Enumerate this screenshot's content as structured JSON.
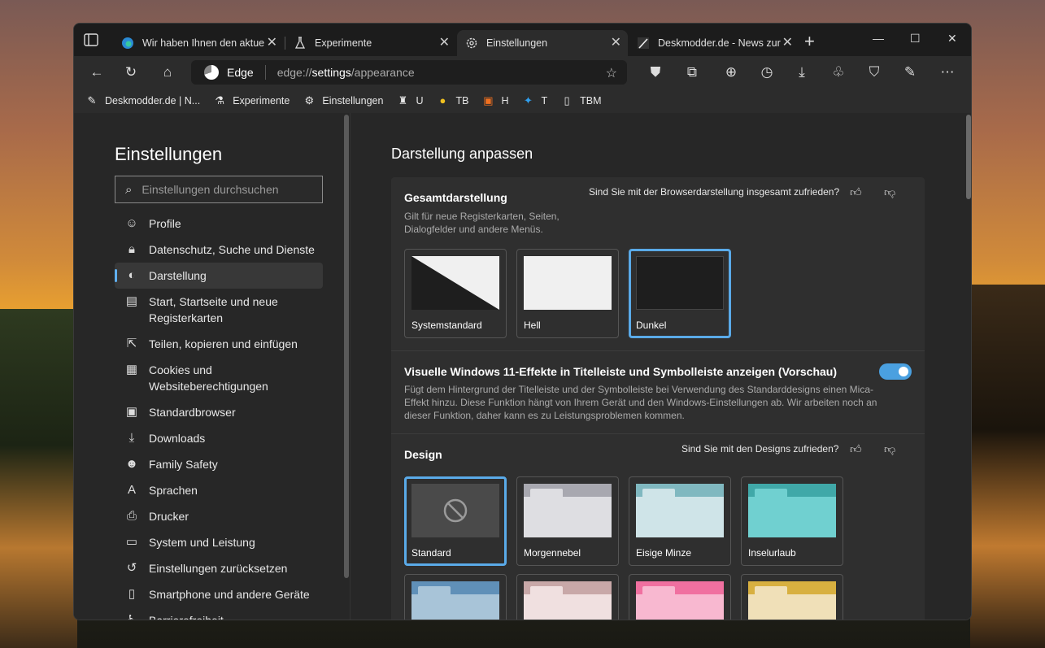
{
  "tabs": [
    {
      "title": "Wir haben Ihnen den aktue",
      "icon": "edge-icon"
    },
    {
      "title": "Experimente",
      "icon": "flask-icon"
    },
    {
      "title": "Einstellungen",
      "icon": "gear-icon"
    },
    {
      "title": "Deskmodder.de - News zur",
      "icon": "feather-icon"
    }
  ],
  "address": {
    "label": "Edge",
    "url_prefix": "edge://",
    "url_bold": "settings",
    "url_rest": "/appearance"
  },
  "bookmarks": [
    {
      "label": "Deskmodder.de | N...",
      "icon": "feather-icon"
    },
    {
      "label": "Experimente",
      "icon": "flask-icon"
    },
    {
      "label": "Einstellungen",
      "icon": "gear-icon"
    },
    {
      "label": "U",
      "icon": "u-icon"
    },
    {
      "label": "TB",
      "icon": "tb-icon"
    },
    {
      "label": "H",
      "icon": "h-icon"
    },
    {
      "label": "T",
      "icon": "twitter-icon"
    },
    {
      "label": "TBM",
      "icon": "page-icon"
    }
  ],
  "sidebar": {
    "title": "Einstellungen",
    "search_placeholder": "Einstellungen durchsuchen",
    "items": [
      {
        "label": "Profile",
        "icon": "profile-icon"
      },
      {
        "label": "Datenschutz, Suche und Dienste",
        "icon": "lock-icon"
      },
      {
        "label": "Darstellung",
        "icon": "palette-icon"
      },
      {
        "label": "Start, Startseite und neue Registerkarten",
        "icon": "home-grid-icon"
      },
      {
        "label": "Teilen, kopieren und einfügen",
        "icon": "share-icon"
      },
      {
        "label": "Cookies und Websiteberechtigungen",
        "icon": "cookie-icon"
      },
      {
        "label": "Standardbrowser",
        "icon": "browser-icon"
      },
      {
        "label": "Downloads",
        "icon": "download-icon"
      },
      {
        "label": "Family Safety",
        "icon": "family-icon"
      },
      {
        "label": "Sprachen",
        "icon": "language-icon"
      },
      {
        "label": "Drucker",
        "icon": "printer-icon"
      },
      {
        "label": "System und Leistung",
        "icon": "laptop-icon"
      },
      {
        "label": "Einstellungen zurücksetzen",
        "icon": "reset-icon"
      },
      {
        "label": "Smartphone und andere Geräte",
        "icon": "phone-icon"
      },
      {
        "label": "Barrierefreiheit",
        "icon": "accessibility-icon"
      }
    ]
  },
  "main": {
    "title": "Darstellung anpassen",
    "overall": {
      "heading": "Gesamtdarstellung",
      "desc": "Gilt für neue Registerkarten, Seiten, Dialogfelder und andere Menüs.",
      "feedback": "Sind Sie mit der Browserdarstellung insgesamt zufrieden?",
      "themes": [
        {
          "label": "Systemstandard"
        },
        {
          "label": "Hell"
        },
        {
          "label": "Dunkel"
        }
      ]
    },
    "mica": {
      "heading": "Visuelle Windows 11-Effekte in Titelleiste und Symbolleiste anzeigen (Vorschau)",
      "desc": "Fügt dem Hintergrund der Titelleiste und der Symbolleiste bei Verwendung des Standarddesigns einen Mica-Effekt hinzu. Diese Funktion hängt von Ihrem Gerät und den Windows-Einstellungen ab. Wir arbeiten noch an dieser Funktion, daher kann es zu Leistungsproblemen kommen.",
      "enabled": true
    },
    "design": {
      "heading": "Design",
      "feedback": "Sind Sie mit den Designs zufrieden?",
      "tiles": [
        {
          "label": "Standard",
          "tab": "#3a3a3a",
          "bar": "#4a4a4a",
          "body": "#4a4a4a"
        },
        {
          "label": "Morgennebel",
          "tab": "#d8d8dc",
          "bar": "#a8a8b0",
          "body": "#dedee2"
        },
        {
          "label": "Eisige Minze",
          "tab": "#d4e8ec",
          "bar": "#80b8c0",
          "body": "#cfe4e8"
        },
        {
          "label": "Inselurlaub",
          "tab": "#70d0d0",
          "bar": "#40a8a8",
          "body": "#70d0d0"
        },
        {
          "label": "",
          "tab": "#b8d0e0",
          "bar": "#6090b8",
          "body": "#a8c4d8"
        },
        {
          "label": "",
          "tab": "#f0e0e0",
          "bar": "#c8a8a8",
          "body": "#f0e0e0"
        },
        {
          "label": "",
          "tab": "#f8c0d8",
          "bar": "#f070a0",
          "body": "#f8b8d0"
        },
        {
          "label": "",
          "tab": "#f0e0b0",
          "bar": "#d8b040",
          "body": "#f0e0b8"
        }
      ]
    }
  },
  "colors": {
    "accent": "#5aaae8",
    "toggle": "#4aa0e0"
  }
}
